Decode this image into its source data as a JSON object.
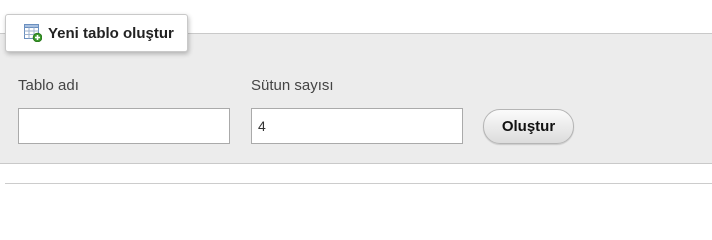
{
  "form": {
    "legend": {
      "title": "Yeni tablo oluştur",
      "icon": "table-add-icon"
    },
    "table_name": {
      "label": "Tablo adı",
      "value": "",
      "placeholder": ""
    },
    "column_count": {
      "label": "Sütun sayısı",
      "value": "4"
    },
    "submit_label": "Oluştur"
  },
  "colors": {
    "panel_background": "#ececec",
    "icon_green": "#3a9a2a",
    "icon_blue": "#6a8fbf"
  }
}
